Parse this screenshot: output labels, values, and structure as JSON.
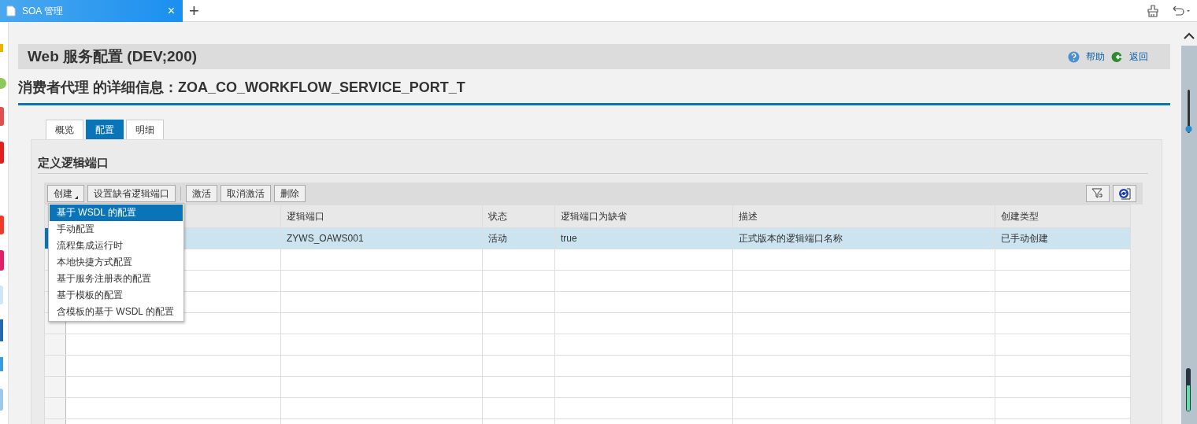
{
  "browser": {
    "tab_title": "SOA 管理",
    "close": "×",
    "new_tab": "+"
  },
  "header": {
    "title": "Web 服务配置 (DEV;200)",
    "help": "帮助",
    "back": "返回"
  },
  "subtitle": "消费者代理 的详细信息：ZOA_CO_WORKFLOW_SERVICE_PORT_T",
  "tabs": [
    {
      "label": "概览",
      "selected": false
    },
    {
      "label": "配置",
      "selected": true
    },
    {
      "label": "明细",
      "selected": false
    }
  ],
  "section_title": "定义逻辑端口",
  "toolbar": [
    {
      "label": "创建",
      "kind": "menu"
    },
    {
      "label": "设置缺省逻辑端口",
      "kind": "button"
    },
    {
      "label": "激活",
      "kind": "button"
    },
    {
      "label": "取消激活",
      "kind": "button"
    },
    {
      "label": "删除",
      "kind": "button"
    }
  ],
  "create_menu": [
    {
      "label": "基于 WSDL 的配置",
      "selected": true
    },
    {
      "label": "手动配置",
      "selected": false
    },
    {
      "label": "流程集成运行时",
      "selected": false
    },
    {
      "label": "本地快捷方式配置",
      "selected": false
    },
    {
      "label": "基于服务注册表的配置",
      "selected": false
    },
    {
      "label": "基于模板的配置",
      "selected": false
    },
    {
      "label": "含模板的基于 WSDL 的配置",
      "selected": false
    }
  ],
  "table": {
    "columns": [
      "逻辑端口",
      "状态",
      "逻辑端口为缺省",
      "描述",
      "创建类型"
    ],
    "rows": [
      {
        "selected": true,
        "cells": [
          "ZYWS_OAWS001",
          "活动",
          "true",
          "正式版本的逻辑端口名称",
          "已手动创建"
        ]
      }
    ]
  }
}
